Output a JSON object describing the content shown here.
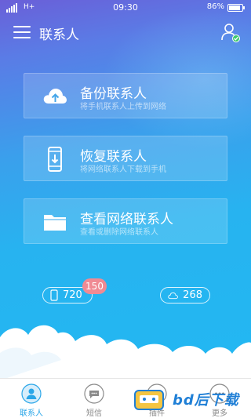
{
  "status_bar": {
    "network": "H+",
    "time": "09:30",
    "battery": "86%",
    "battery_level": 0.86
  },
  "header": {
    "title": "联系人",
    "menu_icon": "hamburger-menu-icon",
    "profile_icon": "user-check-icon"
  },
  "cards": [
    {
      "icon": "cloud-upload-icon",
      "title": "备份联系人",
      "subtitle": "将手机联系人上传到网络"
    },
    {
      "icon": "phone-download-icon",
      "title": "恢复联系人",
      "subtitle": "将网络联系人下载到手机"
    },
    {
      "icon": "folder-icon",
      "title": "查看网络联系人",
      "subtitle": "查看或删除网络联系人"
    }
  ],
  "counters": {
    "local_count": "720",
    "new_badge": "150",
    "cloud_count": "268",
    "local_icon": "phone-icon",
    "cloud_icon": "cloud-icon"
  },
  "bottom_nav": [
    {
      "label": "联系人",
      "icon": "contact-icon",
      "active": true
    },
    {
      "label": "短信",
      "icon": "message-icon",
      "active": false
    },
    {
      "label": "插件",
      "icon": "plugin-icon",
      "active": false
    },
    {
      "label": "更多",
      "icon": "more-icon",
      "active": false
    }
  ],
  "watermark": {
    "text": "bd后下载"
  },
  "colors": {
    "accent": "#2aa6e8",
    "badge": "#f08a93",
    "check": "#3ec96e"
  }
}
